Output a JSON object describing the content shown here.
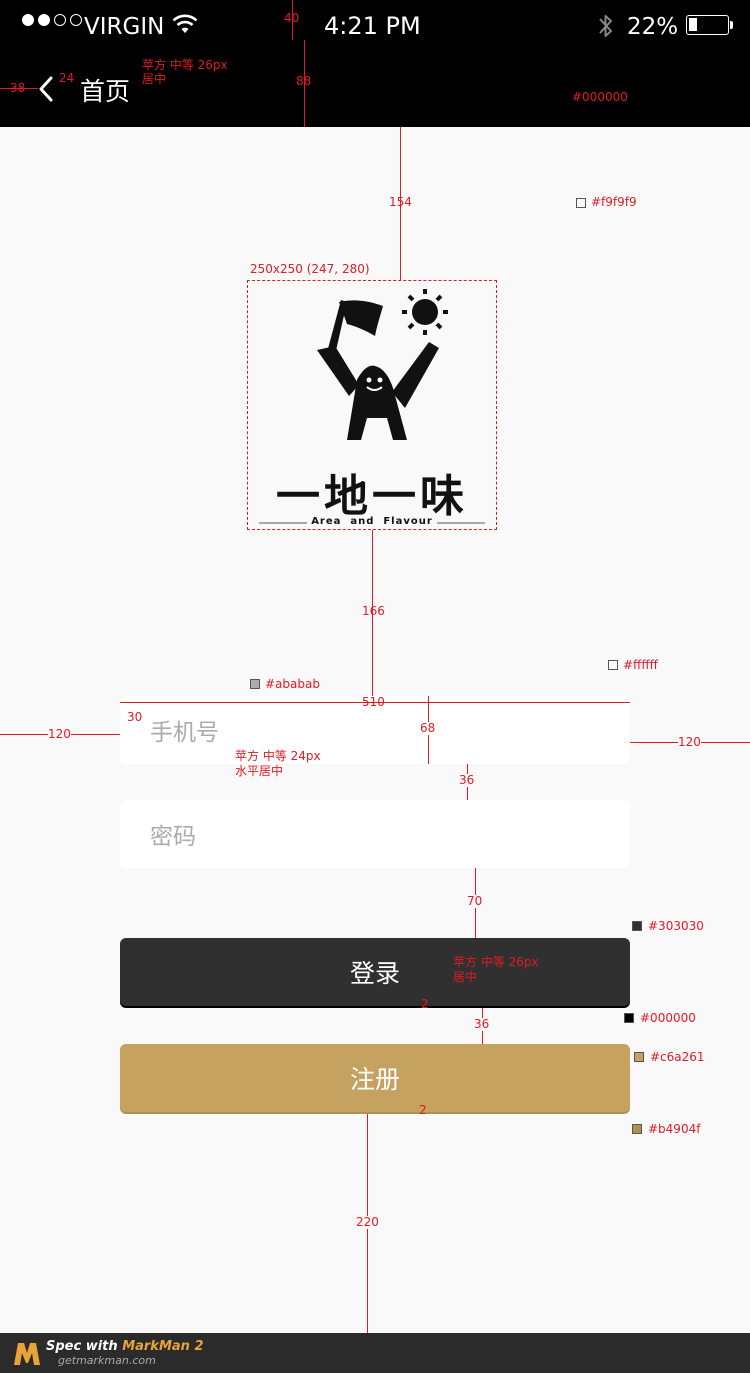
{
  "status_bar": {
    "carrier": "VIRGIN",
    "time": "4:21 PM",
    "battery_percent": "22%",
    "battery_level": 0.22,
    "signal_filled": 2,
    "signal_total": 5
  },
  "nav": {
    "back_label": "首页"
  },
  "logo": {
    "title": "一地一味",
    "subtitle": "Area  and  Flavour"
  },
  "form": {
    "phone_placeholder": "手机号",
    "password_placeholder": "密码",
    "login_label": "登录",
    "register_label": "注册"
  },
  "colors": {
    "nav_bg": "#000000",
    "page_bg": "#f9f9f9",
    "field_bg": "#ffffff",
    "placeholder": "#ababab",
    "login_bg": "#303030",
    "login_shadow": "#000000",
    "register_bg": "#c6a261",
    "register_shadow": "#b4904f"
  },
  "annotations": {
    "nav_height": "88",
    "status_height": "40",
    "back_left": "38",
    "back_gap": "24",
    "nav_font_note": "苹方 中等 26px",
    "nav_font_note2": "居中",
    "black_note": "#000000",
    "bg_note": "#f9f9f9",
    "logo_top_gap": "154",
    "logo_size_note": "250x250 (247, 280)",
    "logo_bottom_gap": "166",
    "field_width": "510",
    "field_padding": "30",
    "field_side_left": "120",
    "field_side_right": "120",
    "field_height": "68",
    "field_gap": "36",
    "placeholder_note": "#ababab",
    "white_note": "#ffffff",
    "field_font_note": "苹方 中等 24px",
    "field_font_note2": "水平居中",
    "button_gap_top": "70",
    "login_color_note": "#303030",
    "login_shadow_note": "#000000",
    "login_font_note": "苹方 中等 26px",
    "login_font_note2": "居中",
    "shadow_2a": "2",
    "button_gap": "36",
    "register_color_note": "#c6a261",
    "register_shadow_note": "#b4904f",
    "shadow_2b": "2",
    "bottom_gap": "220"
  },
  "footer": {
    "spec_label": "Spec with ",
    "brand": "MarkMan 2",
    "url": "getmarkman.com"
  }
}
